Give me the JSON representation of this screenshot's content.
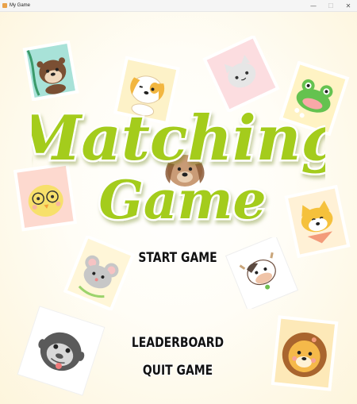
{
  "window": {
    "title": "My Game",
    "minimize": "—",
    "maximize": "☐",
    "close": "✕"
  },
  "game_title": {
    "line1": "Matching",
    "line2": "Game"
  },
  "menu": {
    "start": "START GAME",
    "leaderboard": "LEADERBOARD",
    "quit": "QUIT GAME"
  },
  "cards": [
    "otter",
    "puppy",
    "cat",
    "frog",
    "chick",
    "dog",
    "shiba",
    "mouse",
    "cow",
    "gorilla",
    "lion"
  ],
  "colors": {
    "title_green": "#a4cc1e",
    "title_outline": "#6f9a10",
    "text": "#111111"
  }
}
